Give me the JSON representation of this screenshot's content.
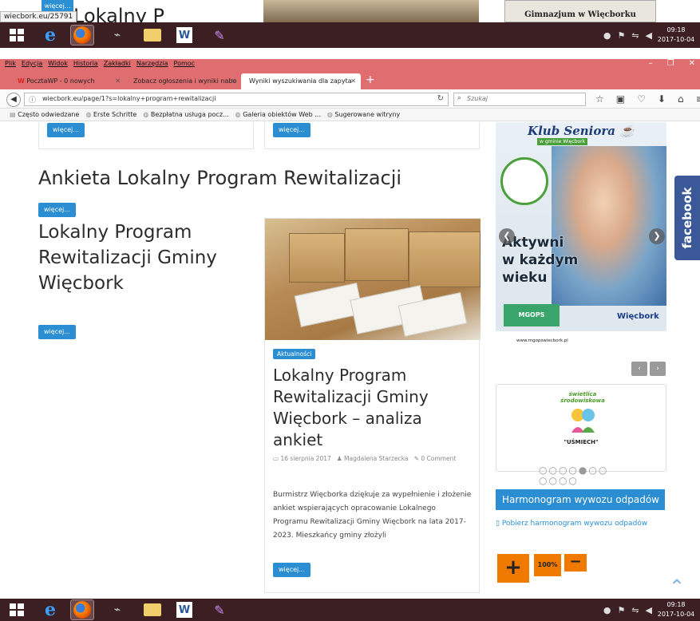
{
  "top_strip": {
    "status_url": "wiecbork.eu/25791",
    "more_button": "więcej...",
    "heading_fragment": "Lokalny P",
    "gimnazjum_caption": "Gimnazjum w Więcborku"
  },
  "taskbar": {
    "time": "09:18",
    "date": "2017-10-04"
  },
  "browser": {
    "menu": [
      "Plik",
      "Edycja",
      "Widok",
      "Historia",
      "Zakładki",
      "Narzędzia",
      "Pomoc"
    ],
    "tabs": [
      {
        "label": "PocztaWP - 0 nowych"
      },
      {
        "label": "Zobacz ogłoszenia i wyniki nabo"
      },
      {
        "label": "Wyniki wyszukiwania dla zapyta"
      }
    ],
    "url": "wiecbork.eu/page/1?s=lokalny+program+rewitalizacji",
    "search_placeholder": "Szukaj",
    "bookmarks": [
      "Często odwiedzane",
      "Erste Schritte",
      "Bezpłatna usługa pocz...",
      "Galeria obiektów Web ...",
      "Sugerowane witryny"
    ]
  },
  "page": {
    "more_label": "więcej...",
    "ankieta_title": "Ankieta Lokalny Program Rewitalizacji",
    "lpr_title": "Lokalny Program Rewitalizacji Gminy Więcbork",
    "article": {
      "category": "Aktualności",
      "title": "Lokalny Program Rewitalizacji Gminy Więcbork – analiza ankiet",
      "date": "16 sierpnia 2017",
      "author": "Magdalena Starzecka",
      "comments": "0 Comment",
      "excerpt": "Burmistrz Więcborka dziękuje za wypełnienie i złożenie ankiet wspierających opracowanie Lokalnego Programu Rewitalizacji Gminy Więcbork na lata 2017-2023. Mieszkańcy gminy złożyli"
    }
  },
  "sidebar": {
    "klub_title": "Klub Seniora",
    "klub_sub": "w gminie Więcbork",
    "klub_slogan_1": "Aktywni",
    "klub_slogan_2": "w każdym",
    "klub_slogan_3": "wieku",
    "mgops": "MGOPS",
    "wiecbork": "Więcbork",
    "klub_url": "www.mgopswiecbork.pl",
    "swietlica_arc": "świetlica środowiskowa",
    "swietlica_name": "\"UŚMIECH\"",
    "harmonogram_heading": "Harmonogram wywozu odpadów",
    "harmonogram_link": "Pobierz harmonogram wywozu odpadów",
    "zoom_level": "100%",
    "facebook": "facebook"
  }
}
